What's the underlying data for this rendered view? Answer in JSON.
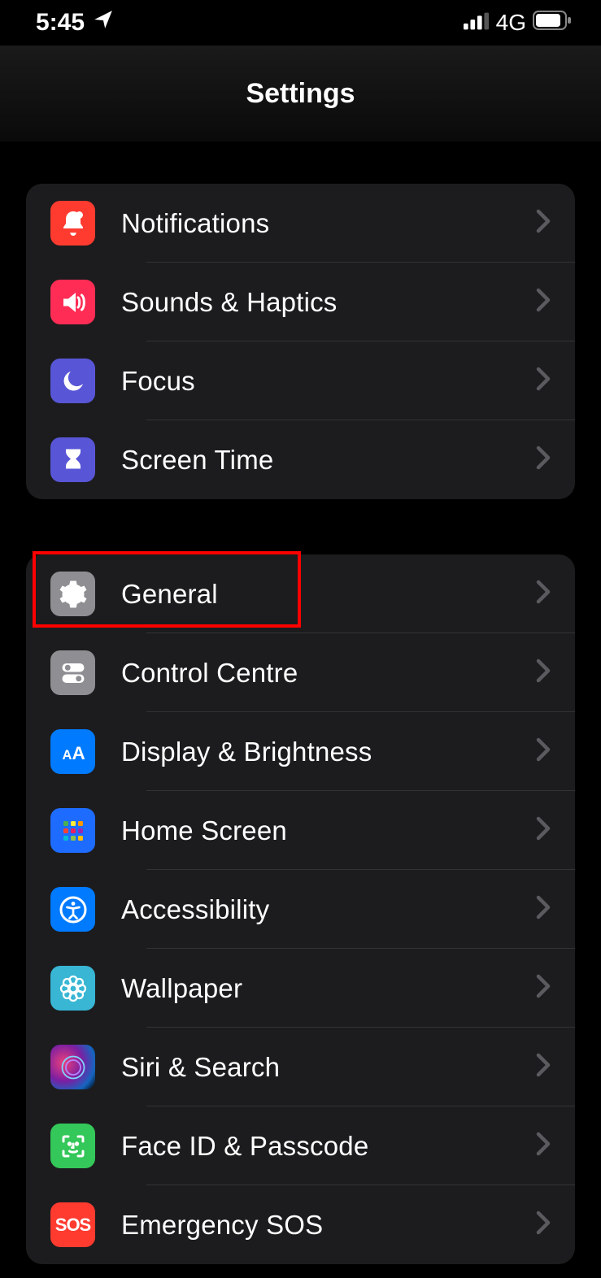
{
  "status": {
    "time": "5:45",
    "network": "4G"
  },
  "header": {
    "title": "Settings"
  },
  "groups": [
    {
      "rows": [
        {
          "label": "Notifications"
        },
        {
          "label": "Sounds & Haptics"
        },
        {
          "label": "Focus"
        },
        {
          "label": "Screen Time"
        }
      ]
    },
    {
      "rows": [
        {
          "label": "General"
        },
        {
          "label": "Control Centre"
        },
        {
          "label": "Display & Brightness"
        },
        {
          "label": "Home Screen"
        },
        {
          "label": "Accessibility"
        },
        {
          "label": "Wallpaper"
        },
        {
          "label": "Siri & Search"
        },
        {
          "label": "Face ID & Passcode"
        },
        {
          "label": "Emergency SOS"
        }
      ]
    }
  ],
  "highlight": {
    "target": "General"
  }
}
